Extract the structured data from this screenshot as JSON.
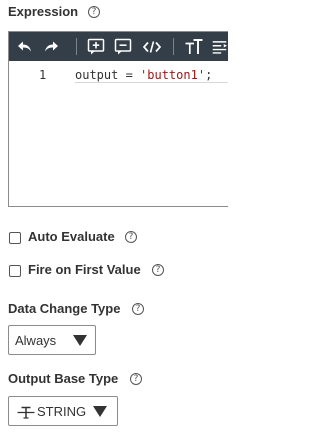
{
  "expression": {
    "label": "Expression",
    "help_icon": "?",
    "toolbar": [
      {
        "icon": "undo-icon"
      },
      {
        "icon": "redo-icon"
      },
      {
        "icon": "insert-comment-icon"
      },
      {
        "icon": "comment-icon"
      },
      {
        "icon": "code-icon"
      },
      {
        "icon": "font-size-icon"
      },
      {
        "icon": "format-icon"
      }
    ],
    "toolbar_color": "#333e48",
    "code": {
      "line_number": "1",
      "prefix": "output = ",
      "string": "'button1'",
      "suffix": ";"
    }
  },
  "auto_evaluate": {
    "label": "Auto Evaluate",
    "help_icon": "?",
    "checked": false
  },
  "fire_on_first_value": {
    "label": "Fire on First Value",
    "help_icon": "?",
    "checked": false
  },
  "data_change_type": {
    "label": "Data Change Type",
    "help_icon": "?",
    "selected": "Always"
  },
  "output_base_type": {
    "label": "Output Base Type",
    "help_icon": "?",
    "type_icon": "string-type-icon",
    "selected": "STRING"
  }
}
